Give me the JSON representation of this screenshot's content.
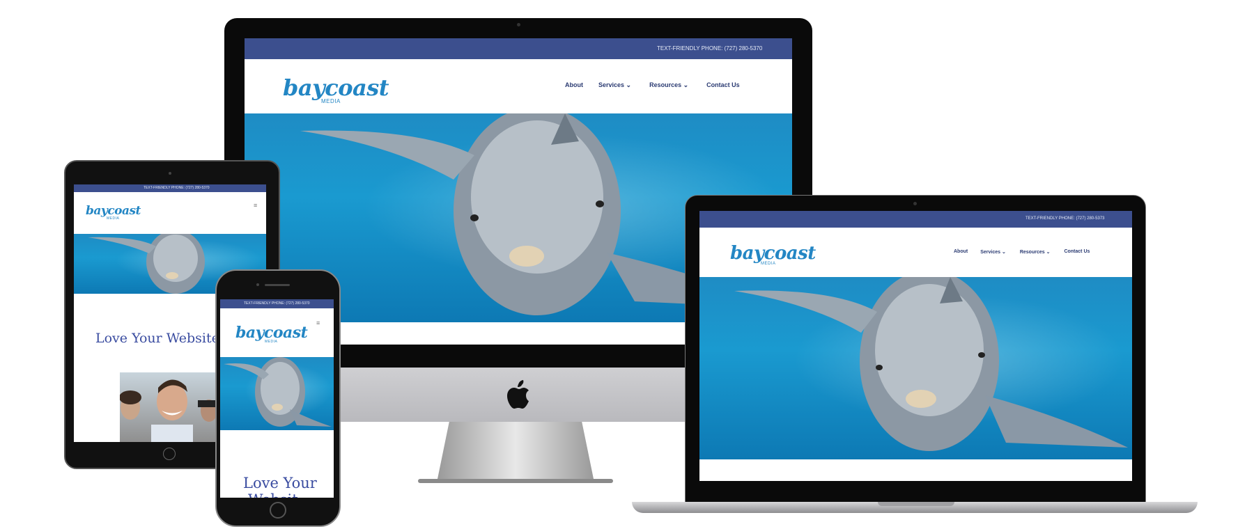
{
  "site": {
    "topbar_text": "TEXT-FRIENDLY PHONE: (727) 280-5370",
    "topbar_text_laptop": "TEXT-FRIENDLY PHONE: (727) 280-5373",
    "topbar_text_tablet": "TEXT-FRIENDLY PHONE: (727) 280-5370",
    "logo_text": "baycoast",
    "logo_sub": "MEDIA",
    "nav": [
      "About",
      "Services ⌄",
      "Resources ⌄",
      "Contact Us"
    ],
    "headline_tablet": "Love Your Website D",
    "headline_phone_1": "Love Your",
    "headline_phone_2": "Websit",
    "menu_icon": "≡"
  },
  "colors": {
    "topbar": "#3c4f8e",
    "logo": "#2386c4",
    "nav": "#2b3b72",
    "headline": "#3a4ca0",
    "ocean": "#1a9ad0"
  },
  "icons": [
    "apple-logo-icon",
    "menu-icon",
    "dolphin-image",
    "people-photo"
  ]
}
